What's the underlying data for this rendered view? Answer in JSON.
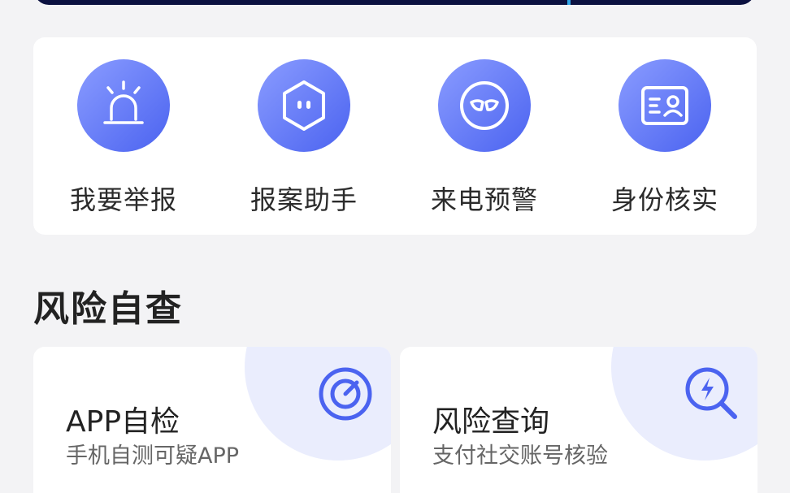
{
  "quick_actions": [
    {
      "label": "我要举报",
      "icon": "alarm-siren-icon"
    },
    {
      "label": "报案助手",
      "icon": "robot-assistant-icon"
    },
    {
      "label": "来电预警",
      "icon": "mask-icon"
    },
    {
      "label": "身份核实",
      "icon": "id-card-icon"
    }
  ],
  "section": {
    "title": "风险自查"
  },
  "cards": [
    {
      "title": "APP自检",
      "subtitle": "手机自测可疑APP",
      "icon": "target-scan-icon"
    },
    {
      "title": "风险查询",
      "subtitle": "支付社交账号核验",
      "icon": "search-lightning-icon"
    }
  ],
  "colors": {
    "accent": "#4b63f0",
    "accent_light": "#8a9cff",
    "background": "#f3f3f5",
    "card": "#ffffff",
    "corner_tint": "#eaedfd"
  }
}
